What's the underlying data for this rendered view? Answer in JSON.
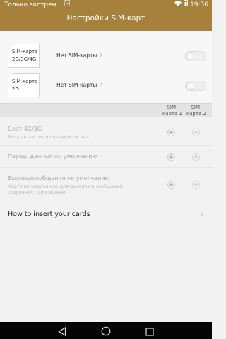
{
  "status_bar": {
    "carrier_text": "Только экстрен...",
    "time": "19:36"
  },
  "header": {
    "title": "Настройки SIM-карт"
  },
  "sims": [
    {
      "name": "SIM-карта 1",
      "network": "2G/3G/4G",
      "status": "Нет SIM-карты",
      "enabled": false
    },
    {
      "name": "SIM-карта 2",
      "network": "2G",
      "status": "Нет SIM-карты",
      "enabled": false
    }
  ],
  "columns": {
    "sim1": {
      "line1": "SIM-",
      "line2": "карта 1"
    },
    "sim2": {
      "line1": "SIM-",
      "line2": "карта 2"
    }
  },
  "options": [
    {
      "title": "Слот 4G/3G",
      "subtitle": "Больше частот и сильный сигнал",
      "selected": "sim1"
    },
    {
      "title": "Перед. данных по умолчанию",
      "subtitle": "",
      "selected": "sim1"
    },
    {
      "title": "Вызовы/сообщения по умолчанию",
      "subtitle": "Карта по умолчанию для вызовов и сообщений сторонних приложений",
      "selected": "sim1"
    }
  ],
  "howto": {
    "label": "How to insert your cards"
  },
  "colors": {
    "header": "#a5813b",
    "background": "#f2f2f2",
    "navbar": "#050505"
  },
  "icons": {
    "status_left": [
      "signal-icon",
      "sim-icon"
    ],
    "status_right": [
      "wifi-icon",
      "battery-icon"
    ],
    "nav": [
      "back-icon",
      "home-icon",
      "recents-icon"
    ]
  }
}
